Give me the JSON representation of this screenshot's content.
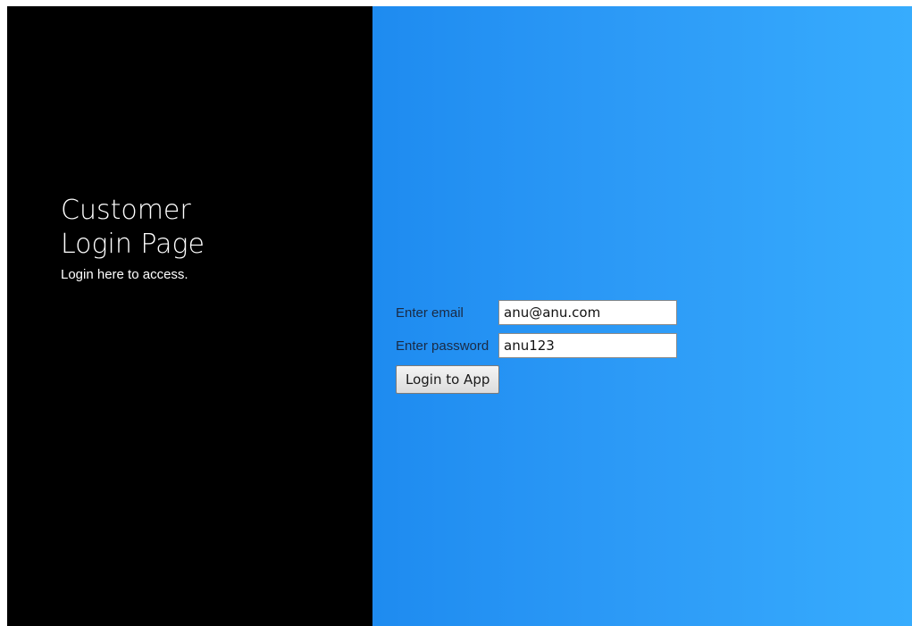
{
  "hero": {
    "title": "Customer Login Page",
    "subtitle": "Login here to access."
  },
  "form": {
    "email_label": "Enter email",
    "email_value": "anu@anu.com",
    "password_label": "Enter password",
    "password_value": "anu123",
    "submit_label": "Login to App"
  },
  "colors": {
    "left_panel": "#000000",
    "gradient_start": "#1e8bf0",
    "gradient_end": "#37acfd"
  }
}
